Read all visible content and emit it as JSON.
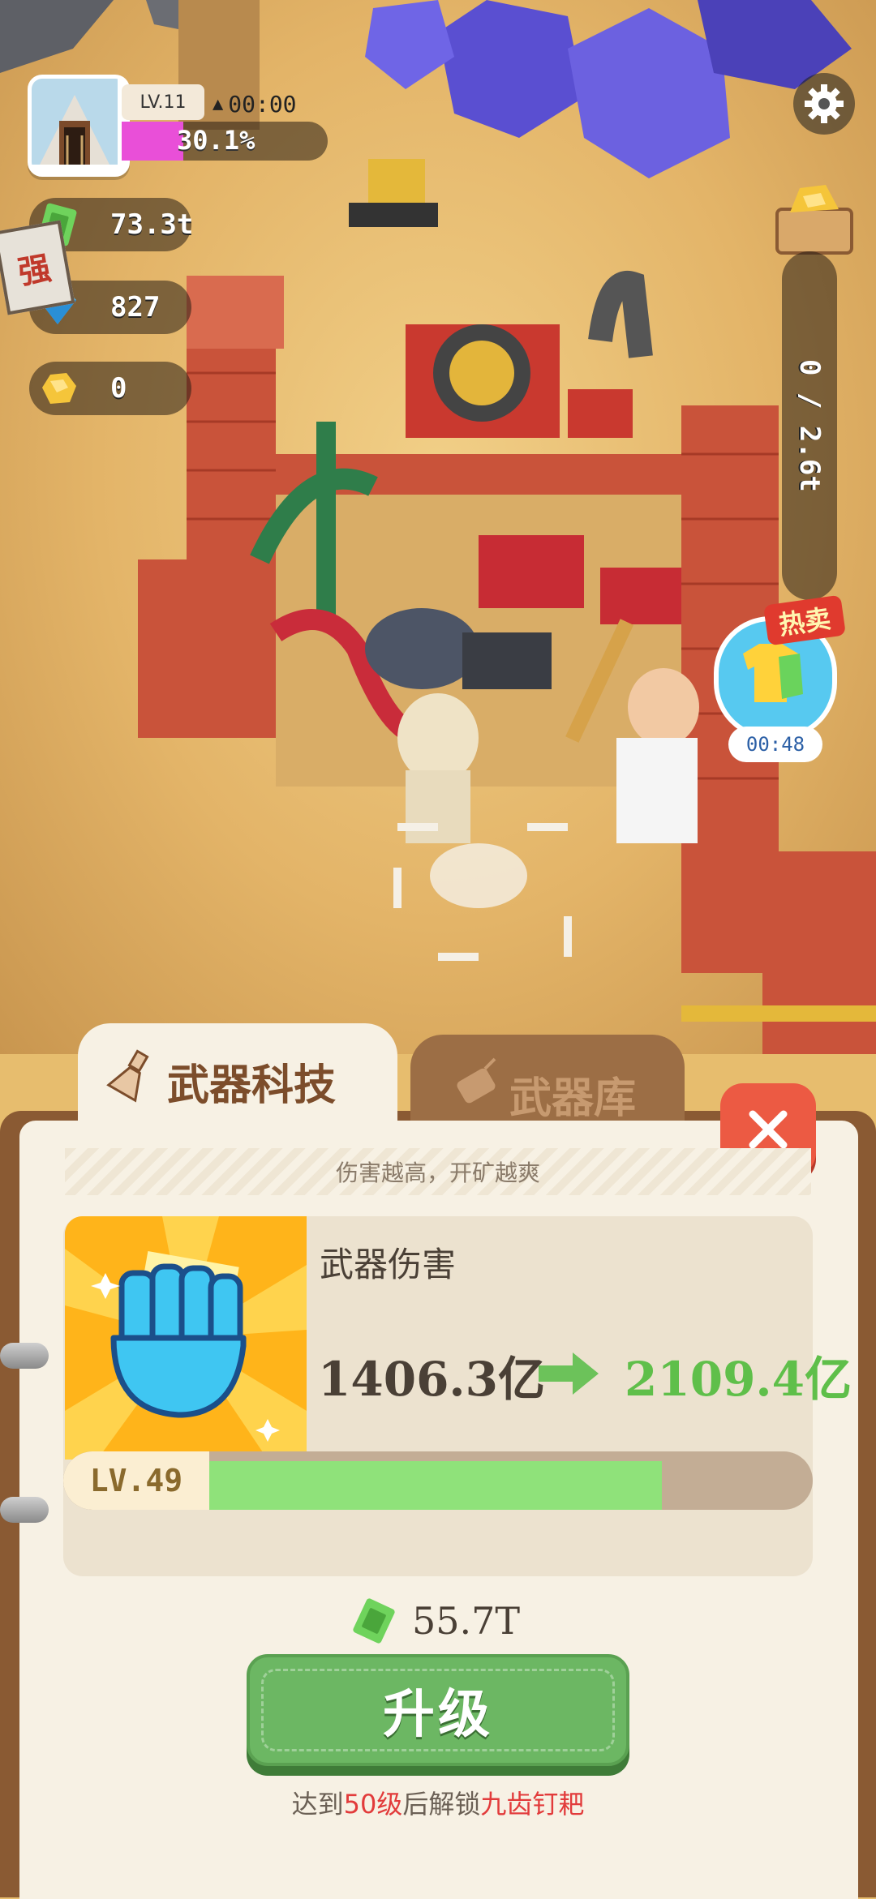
{
  "hud": {
    "level": "LV.11",
    "timer": "00:00",
    "progress_text": "30.1%",
    "progress_value": 0.301,
    "cash": "73.3t",
    "diamonds": "827",
    "gold": "0",
    "side_capacity": "0 / 2.6t",
    "side_badge_label": "强"
  },
  "hot_sale": {
    "label": "热卖",
    "timer": "00:48"
  },
  "tabs": {
    "active": "武器科技",
    "inactive": "武器库"
  },
  "panel": {
    "hint": "伤害越高，开矿越爽",
    "weapon_name": "武器伤害",
    "current_value": "1406.3亿",
    "next_value": "2109.4亿",
    "level": "LV.49",
    "level_progress": 0.75,
    "cost": "55.7T",
    "upgrade_label": "升级",
    "unlock_prefix": "达到",
    "unlock_level": "50级",
    "unlock_middle": "后解锁",
    "unlock_item": "九齿钉耙"
  },
  "colors": {
    "progress_fill": "#e94fd8",
    "next_value": "#5fbf4a",
    "close_button": "#ec5a43",
    "upgrade_button": "#6cb763"
  },
  "icons": {
    "avatar": "mine-entrance-icon",
    "cash": "cash-icon",
    "diamond": "diamond-icon",
    "gold": "gold-nugget-icon",
    "settings": "gear-icon",
    "close": "close-icon",
    "weapon": "fist-icon",
    "arrow": "arrow-right-icon"
  }
}
